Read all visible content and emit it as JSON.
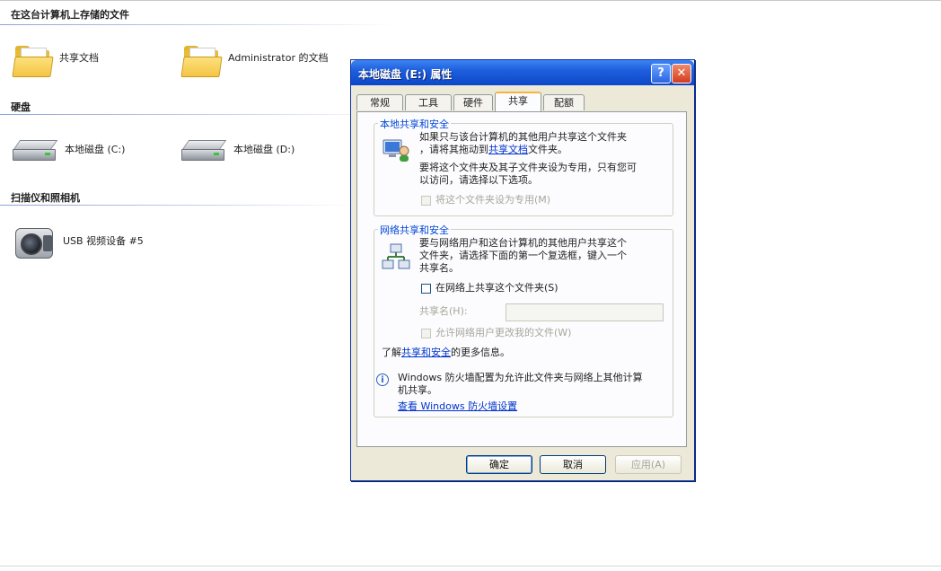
{
  "explorer": {
    "sections": [
      {
        "header": "在这台计算机上存储的文件",
        "items": [
          {
            "label": "共享文档",
            "icon": "folder-icon"
          },
          {
            "label": "Administrator 的文档",
            "icon": "folder-icon"
          }
        ]
      },
      {
        "header": "硬盘",
        "items": [
          {
            "label": "本地磁盘 (C:)",
            "icon": "hard-drive-icon"
          },
          {
            "label": "本地磁盘 (D:)",
            "icon": "hard-drive-icon"
          }
        ]
      },
      {
        "header": "扫描仪和照相机",
        "items": [
          {
            "label": "USB 视频设备 #5",
            "icon": "camera-icon"
          }
        ]
      }
    ]
  },
  "dialog": {
    "title": "本地磁盘 (E:) 属性",
    "help_glyph": "?",
    "close_glyph": "✕",
    "tabs": [
      {
        "label": "常规",
        "active": false
      },
      {
        "label": "工具",
        "active": false
      },
      {
        "label": "硬件",
        "active": false
      },
      {
        "label": "共享",
        "active": true
      },
      {
        "label": "配额",
        "active": false
      }
    ],
    "local_sharing": {
      "title": "本地共享和安全",
      "text_line1": "如果只与该台计算机的其他用户共享这个文件夹",
      "text_line2_prefix": "，请将其拖动到",
      "text_link": "共享文档",
      "text_line2_suffix": "文件夹。",
      "text2_line1": "要将这个文件夹及其子文件夹设为专用，只有您可",
      "text2_line2": "以访问，请选择以下选项。",
      "private_checkbox_label": "将这个文件夹设为专用(M)",
      "private_checked": false
    },
    "network_sharing": {
      "title": "网络共享和安全",
      "text_line1": "要与网络用户和这台计算机的其他用户共享这个",
      "text_line2": "文件夹，请选择下面的第一个复选框，键入一个",
      "text_line3": "共享名。",
      "share_checkbox_label": "在网络上共享这个文件夹(S)",
      "share_checked": false,
      "share_name_label": "共享名(H):",
      "share_name_value": "",
      "allow_change_label": "允许网络用户更改我的文件(W)",
      "allow_change_checked": false,
      "learn_prefix": "了解",
      "learn_link": "共享和安全",
      "learn_suffix": "的更多信息。"
    },
    "firewall": {
      "line1": "Windows 防火墙配置为允许此文件夹与网络上其他计算",
      "line2": "机共享。",
      "link": "查看 Windows 防火墙设置"
    },
    "buttons": {
      "ok": "确定",
      "cancel": "取消",
      "apply": "应用(A)"
    }
  },
  "colors": {
    "titlebar": "#0d47c9",
    "dialog_bg": "#ece9d8",
    "link": "#0033cc"
  }
}
